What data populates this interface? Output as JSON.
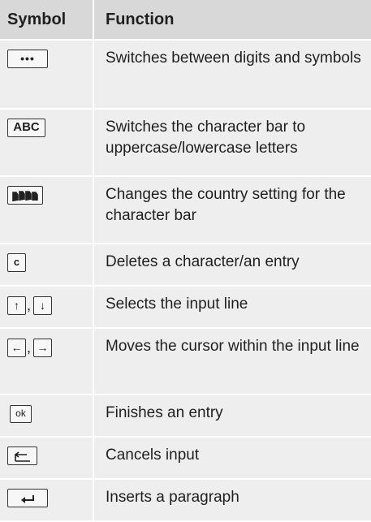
{
  "table": {
    "header_symbol": "Symbol",
    "header_function": "Function",
    "rows": [
      {
        "icon": "more-symbols-key-icon",
        "key_text": "•••",
        "function": "Switches between digits and symbols"
      },
      {
        "icon": "abc-key-icon",
        "key_text": "ABC",
        "function": "Switches the character bar to uppercase/lowercase letters"
      },
      {
        "icon": "country-flags-key-icon",
        "key_text": "",
        "function": "Changes the country setting for the character bar"
      },
      {
        "icon": "delete-c-key-icon",
        "key_text": "c",
        "function": "Deletes a character/an entry"
      },
      {
        "icon": "up-down-arrow-keys-icon",
        "key_text_1": "↑",
        "separator": ",",
        "key_text_2": "↓",
        "function": "Selects the input line"
      },
      {
        "icon": "left-right-arrow-keys-icon",
        "key_text_1": "←",
        "separator": ",",
        "key_text_2": "→",
        "function": "Moves the cursor within the input line"
      },
      {
        "icon": "ok-key-icon",
        "key_text": "ok",
        "function": "Finishes an entry"
      },
      {
        "icon": "back-key-icon",
        "key_text": "",
        "function": "Cancels input"
      },
      {
        "icon": "enter-key-icon",
        "key_text": "",
        "function": "Inserts a paragraph"
      }
    ]
  }
}
